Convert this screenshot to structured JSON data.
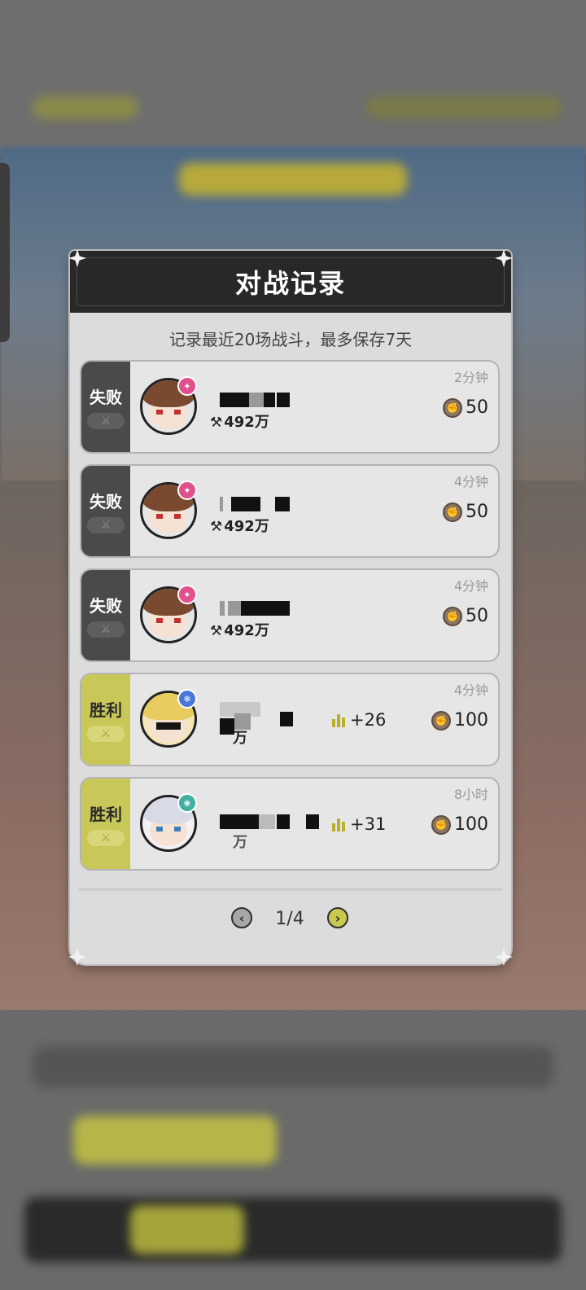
{
  "modal": {
    "title": "对战记录",
    "subtitle": "记录最近20场战斗，最多保存7天"
  },
  "records": [
    {
      "result": "失败",
      "outcome": "lose",
      "time": "2分钟",
      "power": "492万",
      "coins": "50",
      "avatar": "brown-hair-icon",
      "badge": "pink"
    },
    {
      "result": "失败",
      "outcome": "lose",
      "time": "4分钟",
      "power": "492万",
      "coins": "50",
      "avatar": "brown-hair-icon",
      "badge": "pink"
    },
    {
      "result": "失败",
      "outcome": "lose",
      "time": "4分钟",
      "power": "492万",
      "coins": "50",
      "avatar": "brown-hair-icon",
      "badge": "pink"
    },
    {
      "result": "胜利",
      "outcome": "win",
      "time": "4分钟",
      "power": "万",
      "rank": "+26",
      "coins": "100",
      "avatar": "blonde-hair-icon",
      "badge": "blue"
    },
    {
      "result": "胜利",
      "outcome": "win",
      "time": "8小时",
      "power": "万",
      "rank": "+31",
      "coins": "100",
      "avatar": "silver-hair-icon",
      "badge": "teal"
    }
  ],
  "pager": {
    "indicator": "1/4"
  },
  "colors": {
    "win": "#c8c858",
    "lose": "#4a4a4a",
    "header": "#282828"
  }
}
